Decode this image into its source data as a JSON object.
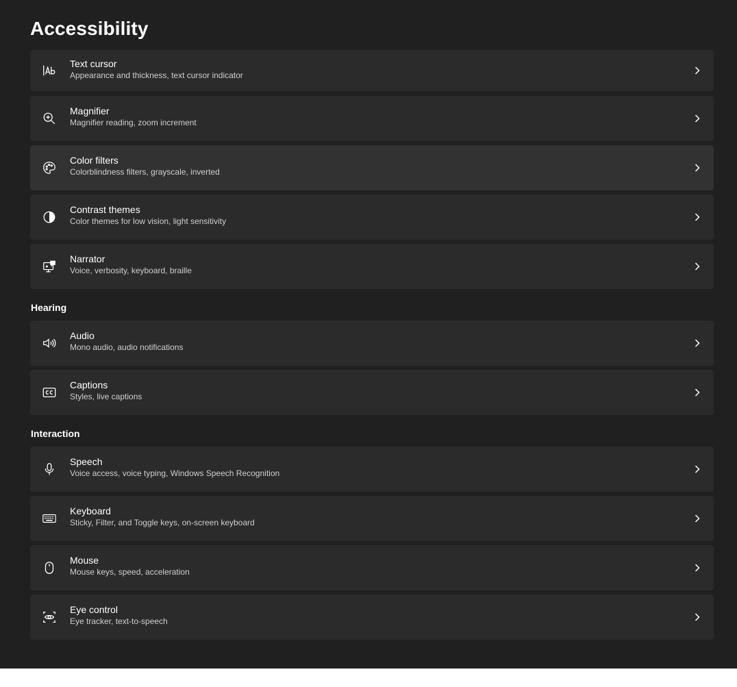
{
  "page": {
    "title": "Accessibility"
  },
  "sections": {
    "hearing": "Hearing",
    "interaction": "Interaction"
  },
  "items": [
    {
      "title": "Text cursor",
      "desc": "Appearance and thickness, text cursor indicator",
      "icon": "text-cursor-icon"
    },
    {
      "title": "Magnifier",
      "desc": "Magnifier reading, zoom increment",
      "icon": "magnifier-icon"
    },
    {
      "title": "Color filters",
      "desc": "Colorblindness filters, grayscale, inverted",
      "icon": "palette-icon"
    },
    {
      "title": "Contrast themes",
      "desc": "Color themes for low vision, light sensitivity",
      "icon": "contrast-icon"
    },
    {
      "title": "Narrator",
      "desc": "Voice, verbosity, keyboard, braille",
      "icon": "narrator-icon"
    },
    {
      "title": "Audio",
      "desc": "Mono audio, audio notifications",
      "icon": "speaker-icon"
    },
    {
      "title": "Captions",
      "desc": "Styles, live captions",
      "icon": "captions-icon"
    },
    {
      "title": "Speech",
      "desc": "Voice access, voice typing, Windows Speech Recognition",
      "icon": "microphone-icon"
    },
    {
      "title": "Keyboard",
      "desc": "Sticky, Filter, and Toggle keys, on-screen keyboard",
      "icon": "keyboard-icon"
    },
    {
      "title": "Mouse",
      "desc": "Mouse keys, speed, acceleration",
      "icon": "mouse-icon"
    },
    {
      "title": "Eye control",
      "desc": "Eye tracker, text-to-speech",
      "icon": "eye-control-icon"
    }
  ],
  "colors": {
    "background": "#202020",
    "card": "#2b2b2b",
    "card_hover": "#323232",
    "text": "#ffffff",
    "secondary_text": "#cfcfcf"
  }
}
